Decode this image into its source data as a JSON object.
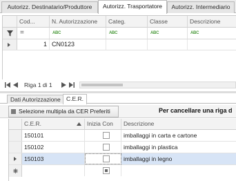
{
  "tabs": [
    {
      "label": "Autorizz. Destinatario/Produttore",
      "active": false
    },
    {
      "label": "Autorizz. Trasportatore",
      "active": true
    },
    {
      "label": "Autorizz. Intermediario",
      "active": false
    }
  ],
  "grid_top": {
    "columns": [
      "Cod...",
      "N. Autorizzazione",
      "Categ.",
      "Classe",
      "Descrizione"
    ],
    "filter_symbol": "=",
    "filter_abc": "ABC",
    "rows": [
      {
        "cod": "1",
        "n_autorizzazione": "CN0123",
        "categ": "",
        "classe": "",
        "descrizione": ""
      }
    ]
  },
  "navigator": {
    "text": "Riga 1 di 1"
  },
  "lower_tabs": [
    {
      "label": "Dati Autorizzazione",
      "active": false
    },
    {
      "label": "C.E.R.",
      "active": true
    }
  ],
  "toolbar": {
    "button_label": "Selezione multipla da CER Preferiti",
    "hint": "Per cancellare una riga d"
  },
  "grid_cer": {
    "columns": [
      "C.E.R.",
      "Inizia Con",
      "Descrizione"
    ],
    "rows": [
      {
        "cer": "150101",
        "inizia_con": false,
        "descrizione": "imballaggi in carta e cartone"
      },
      {
        "cer": "150102",
        "inizia_con": false,
        "descrizione": "imballaggi in plastica"
      },
      {
        "cer": "150103",
        "inizia_con": false,
        "descrizione": "imballaggi in legno"
      }
    ],
    "selected_row": 2
  }
}
